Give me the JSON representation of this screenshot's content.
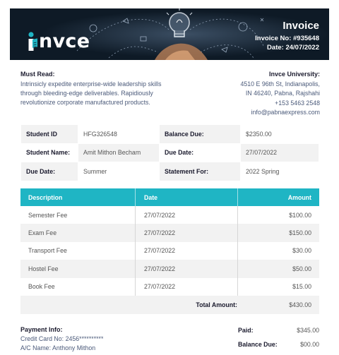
{
  "header": {
    "brand": "nvce",
    "title": "Invoice",
    "invoice_no_label": "Invoice No:",
    "invoice_no": "#935648",
    "date_label": "Date:",
    "date": "24/07/2022"
  },
  "must_read": {
    "label": "Must Read:",
    "lines": [
      "Intrinsicly expedite enterprise-wide leadership skills",
      "through bleeding-edge deliverables. Rapidiously",
      "revolutionize corporate manufactured products."
    ]
  },
  "university": {
    "name": "Invce University:",
    "lines": [
      "4510 E 96th St, Indianapolis,",
      "IN 46240, Pabna, Rajshahi",
      "+153 5463 2548",
      "info@pabnaexpress.com"
    ]
  },
  "student_info": [
    [
      "Student ID",
      "HFG326548",
      "Balance Due:",
      "$2350.00"
    ],
    [
      "Student Name:",
      "Amit Mithon Becham",
      "Due Date:",
      "27/07/2022"
    ],
    [
      "Due Date:",
      "Summer",
      "Statement For:",
      "2022 Spring"
    ]
  ],
  "fees": {
    "headers": [
      "Description",
      "Date",
      "Amount"
    ],
    "rows": [
      [
        "Semester Fee",
        "27/07/2022",
        "$100.00"
      ],
      [
        "Exam Fee",
        "27/07/2022",
        "$150.00"
      ],
      [
        "Transport Fee",
        "27/07/2022",
        "$30.00"
      ],
      [
        "Hostel Fee",
        "27/07/2022",
        "$50.00"
      ],
      [
        "Book Fee",
        "27/07/2022",
        "$15.00"
      ]
    ],
    "total_label": "Total Amount:",
    "total_value": "$430.00"
  },
  "payment": {
    "label": "Payment Info:",
    "card_label": "Credit Card No:",
    "card_no": "2456**********",
    "name_label": "A/C Name:",
    "name": "Anthony Mithon",
    "paid_label": "Paid:",
    "paid": "$345.00",
    "balance_label": "Balance Due:",
    "balance": "$00.00"
  },
  "colors": {
    "accent": "#1fb5c4",
    "banner": "#0e1a26",
    "shade": "#f2f2f2"
  }
}
